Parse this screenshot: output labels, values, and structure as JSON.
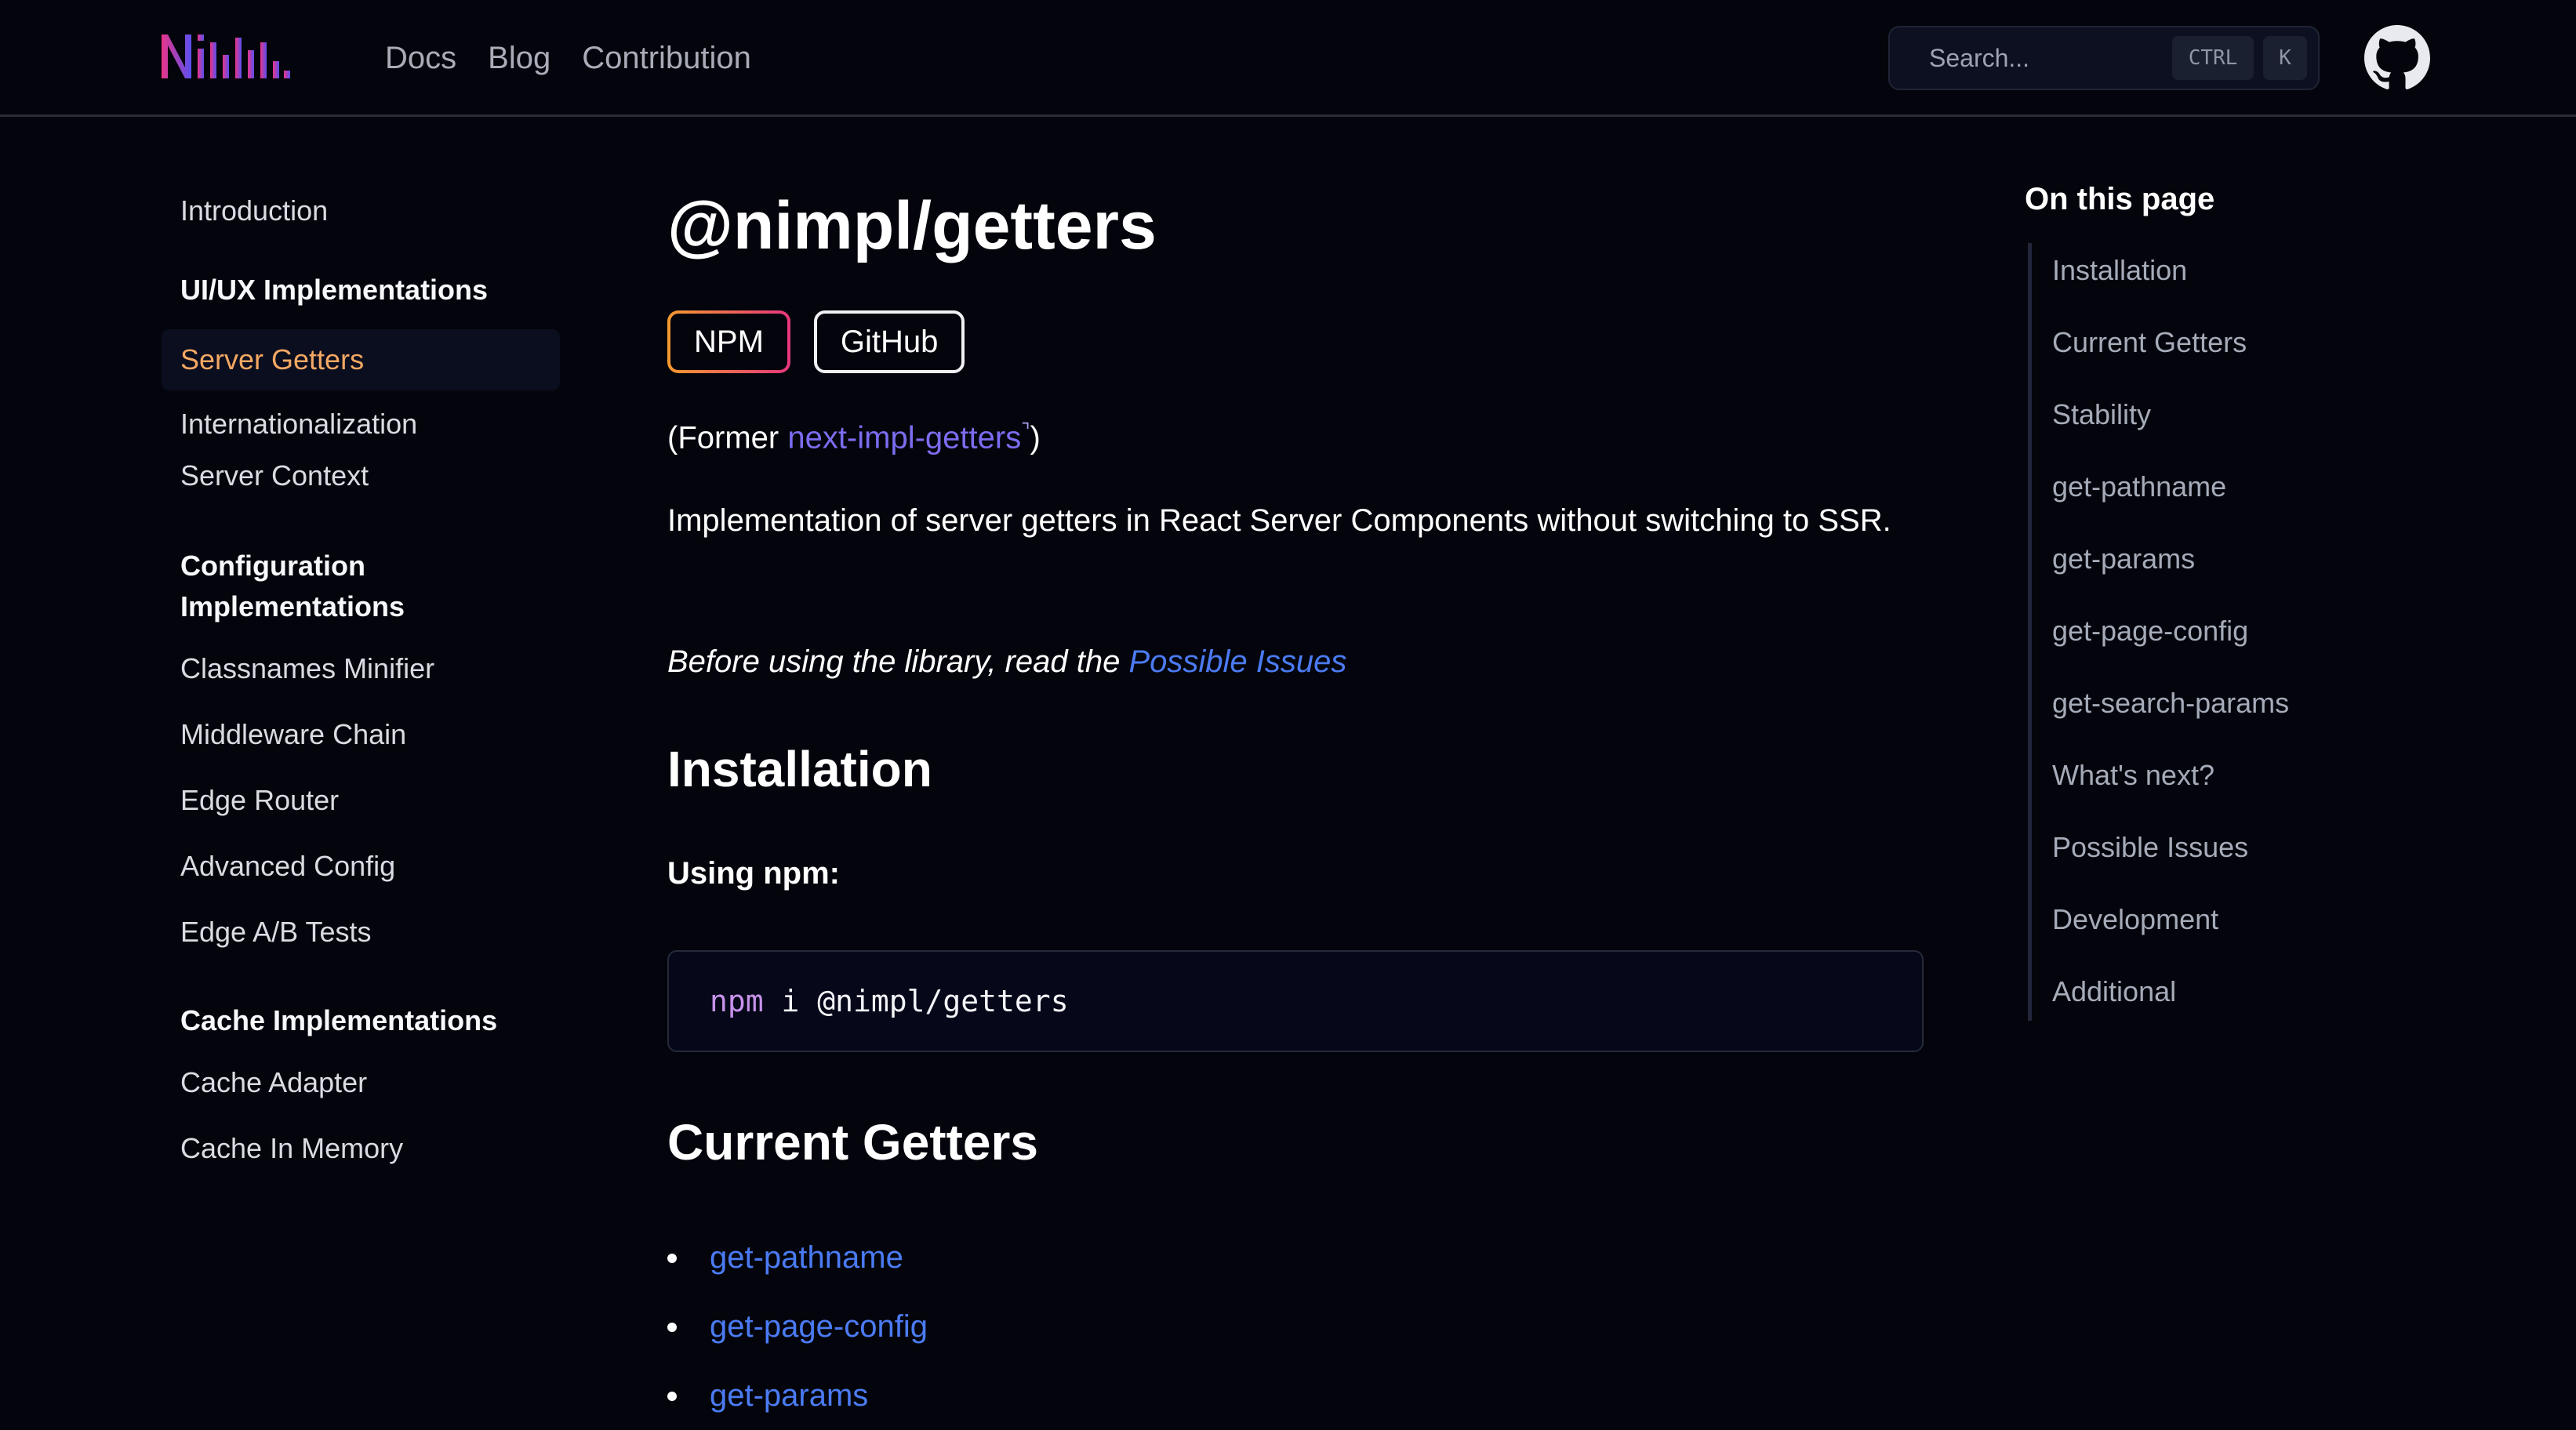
{
  "header": {
    "nav": [
      "Docs",
      "Blog",
      "Contribution"
    ],
    "search": {
      "placeholder": "Search...",
      "shortcut_ctrl": "CTRL",
      "shortcut_key": "K"
    }
  },
  "sidebar": {
    "intro": "Introduction",
    "groups": [
      {
        "heading": "UI/UX Implementations",
        "items": [
          "Server Getters",
          "Internationalization",
          "Server Context"
        ],
        "active": "Server Getters"
      },
      {
        "heading": "Configuration Implementations",
        "items": [
          "Classnames Minifier",
          "Middleware Chain",
          "Edge Router",
          "Advanced Config",
          "Edge A/B Tests"
        ]
      },
      {
        "heading": "Cache Implementations",
        "items": [
          "Cache Adapter",
          "Cache In Memory"
        ]
      }
    ]
  },
  "main": {
    "title": "@nimpl/getters",
    "badges": [
      "NPM",
      "GitHub"
    ],
    "former_prefix": "(Former ",
    "former_link": "next-impl-getters",
    "former_suffix": ")",
    "description": "Implementation of server getters in React Server Components without switching to SSR.",
    "note_prefix": "Before using the library, read the ",
    "note_link": "Possible Issues",
    "installation_heading": "Installation",
    "using_npm": "Using npm:",
    "code_cmd": "npm",
    "code_rest": " i @nimpl/getters",
    "current_heading": "Current Getters",
    "getters": [
      "get-pathname",
      "get-page-config",
      "get-params"
    ]
  },
  "toc": {
    "title": "On this page",
    "items": [
      "Installation",
      "Current Getters",
      "Stability",
      "get-pathname",
      "get-params",
      "get-page-config",
      "get-search-params",
      "What's next?",
      "Possible Issues",
      "Development",
      "Additional"
    ]
  },
  "colors": {
    "background": "#04050c",
    "active_link": "#f4a863",
    "link_purple": "#7b6cf0",
    "link_blue": "#4b7bf3",
    "logo_pink": "#e8348a",
    "logo_purple": "#6a58f0"
  },
  "icons": [
    "nimpl-logo",
    "github-icon",
    "external-link-icon"
  ]
}
